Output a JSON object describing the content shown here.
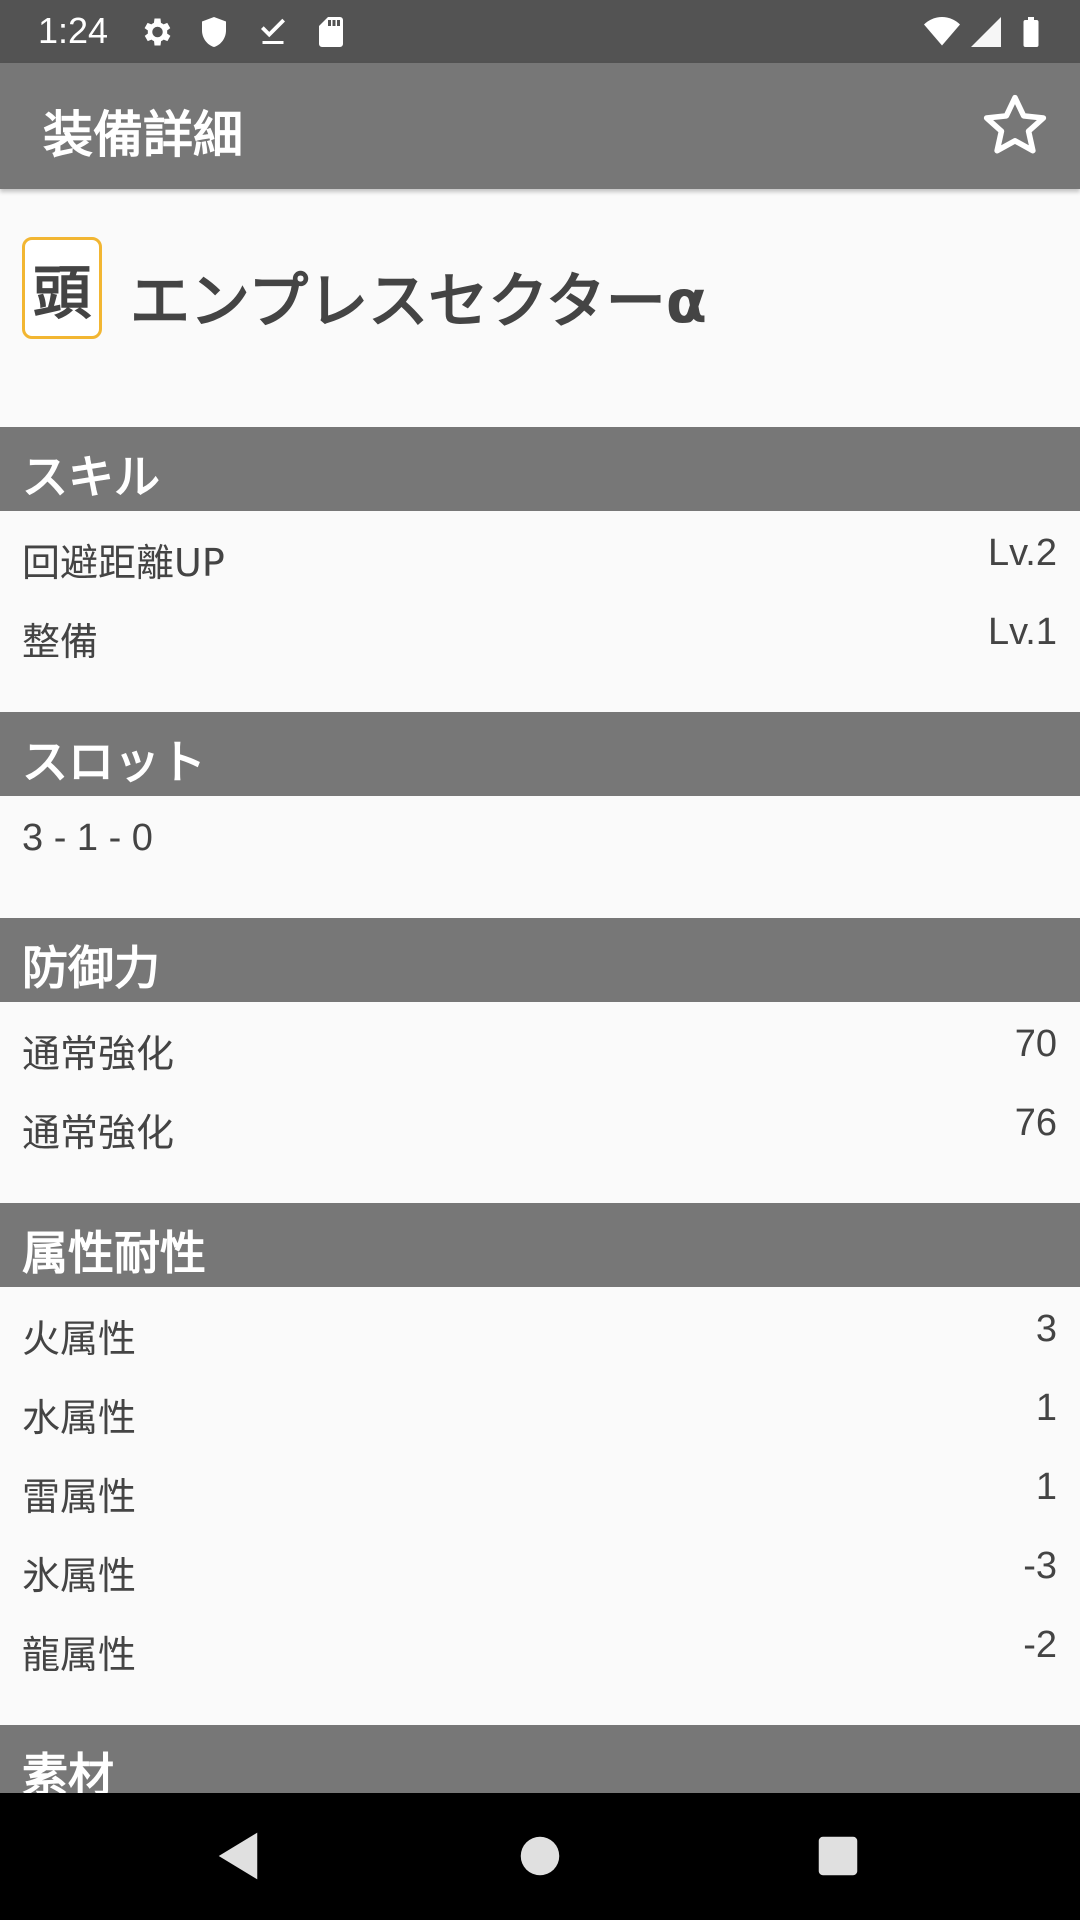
{
  "status_bar": {
    "time": "1:24",
    "left_icons": [
      "gear-icon",
      "shield-icon",
      "download-done-icon",
      "sd-card-icon"
    ],
    "right_icons": [
      "wifi-icon",
      "cell-signal-icon",
      "battery-icon"
    ]
  },
  "app_bar": {
    "title": "装備詳細",
    "favorite_icon": "star-outline-icon"
  },
  "item": {
    "slot_badge": "頭",
    "badge_color": "#f2b632",
    "name": "エンプレスセクターα"
  },
  "sections": {
    "skills": {
      "title": "スキル",
      "rows": [
        {
          "label": "回避距離UP",
          "value": "Lv.2"
        },
        {
          "label": "整備",
          "value": "Lv.1"
        }
      ]
    },
    "slots": {
      "title": "スロット",
      "value": "3 - 1 - 0"
    },
    "defense": {
      "title": "防御力",
      "rows": [
        {
          "label": "通常強化",
          "value": "70"
        },
        {
          "label": "通常強化",
          "value": "76"
        }
      ]
    },
    "resistances": {
      "title": "属性耐性",
      "rows": [
        {
          "label": "火属性",
          "value": "3"
        },
        {
          "label": "水属性",
          "value": "1"
        },
        {
          "label": "雷属性",
          "value": "1"
        },
        {
          "label": "氷属性",
          "value": "-3"
        },
        {
          "label": "龍属性",
          "value": "-2"
        }
      ]
    },
    "materials": {
      "title": "素材"
    }
  },
  "nav_bar": {
    "buttons": [
      "back-icon",
      "home-icon",
      "recents-icon"
    ]
  },
  "colors": {
    "app_bar": "#777777",
    "status_bar": "#535353",
    "section_header": "#777777",
    "background": "#fafafa"
  }
}
